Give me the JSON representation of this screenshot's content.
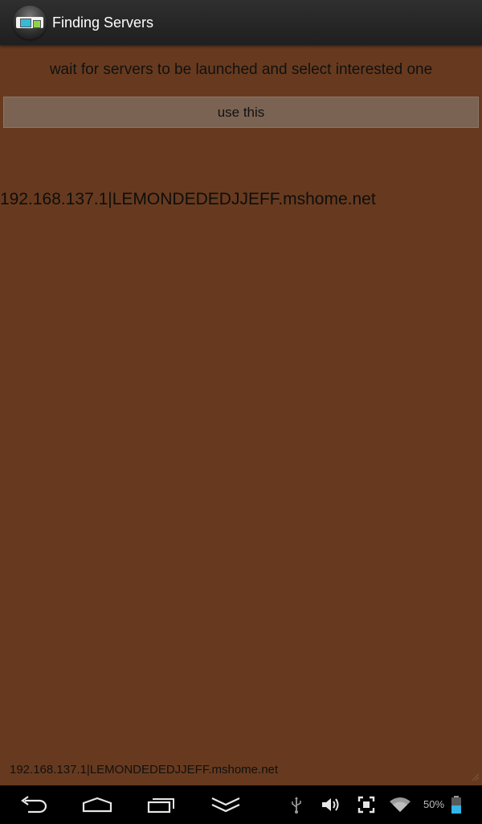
{
  "action_bar": {
    "title": "Finding Servers",
    "app_icon": "server-finder-app-icon"
  },
  "main": {
    "instructions": "wait for servers to be launched and select interested one",
    "use_button_label": "use this",
    "servers": [
      "192.168.137.1|LEMONDEDEDJJEFF.mshome.net"
    ],
    "selected_server": "192.168.137.1|LEMONDEDEDJJEFF.mshome.net"
  },
  "nav_bar": {
    "buttons": [
      "back-icon",
      "home-icon",
      "recent-apps-icon",
      "hide-keyboard-icon"
    ],
    "status_icons": [
      "usb-icon",
      "volume-icon",
      "screenshot-icon",
      "wifi-icon",
      "battery-icon"
    ],
    "battery_percent": "50%"
  },
  "colors": {
    "background": "#673a1f",
    "action_bar": "#262626",
    "button": "#7b6353",
    "nav_bar": "#000000",
    "battery_fill": "#33b5e5"
  }
}
